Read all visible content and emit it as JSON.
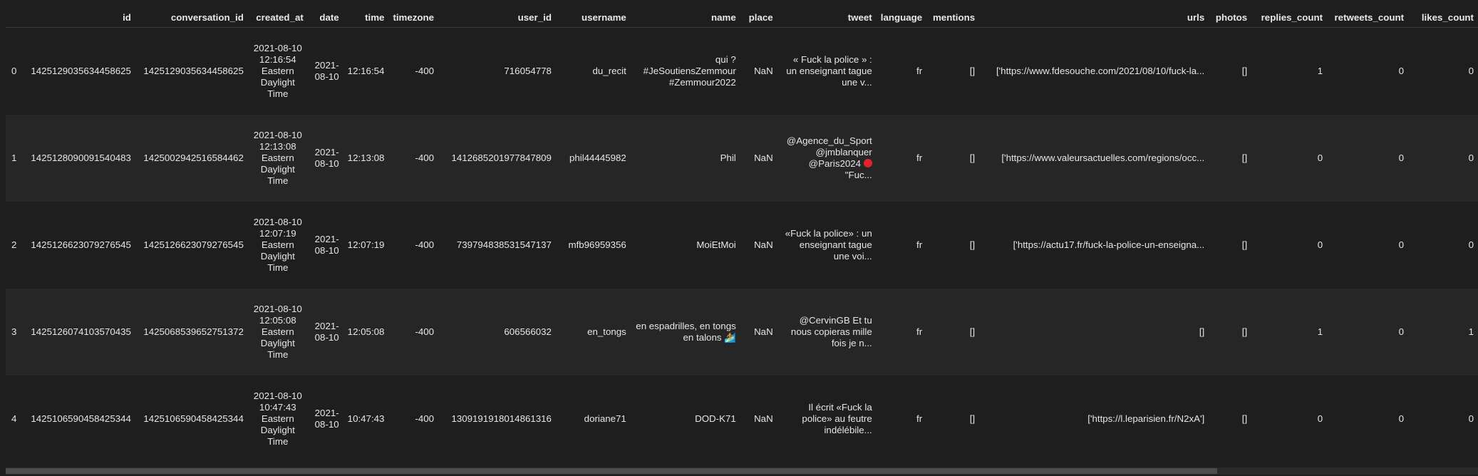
{
  "columns": [
    "",
    "id",
    "conversation_id",
    "created_at",
    "date",
    "time",
    "timezone",
    "user_id",
    "username",
    "name",
    "place",
    "tweet",
    "language",
    "mentions",
    "urls",
    "photos",
    "replies_count",
    "retweets_count",
    "likes_count"
  ],
  "rows": [
    {
      "index": "0",
      "id": "1425129035634458625",
      "conversation_id": "1425129035634458625",
      "created_at": "2021-08-10 12:16:54 Eastern Daylight Time",
      "date": "2021-08-10",
      "time": "12:16:54",
      "timezone": "-400",
      "user_id": "716054778",
      "username": "du_recit",
      "name": "qui ? #JeSoutiensZemmour #Zemmour2022",
      "place": "NaN",
      "tweet": "« Fuck la police » : un enseignant tague une v...",
      "language": "fr",
      "mentions": "[]",
      "urls": "['https://www.fdesouche.com/2021/08/10/fuck-la...",
      "photos": "[]",
      "replies_count": "1",
      "retweets_count": "0",
      "likes_count": "0"
    },
    {
      "index": "1",
      "id": "1425128090091540483",
      "conversation_id": "1425002942516584462",
      "created_at": "2021-08-10 12:13:08 Eastern Daylight Time",
      "date": "2021-08-10",
      "time": "12:13:08",
      "timezone": "-400",
      "user_id": "1412685201977847809",
      "username": "phil44445982",
      "name": "Phil",
      "place": "NaN",
      "tweet_before_dot": "@Agence_du_Sport @jmblanquer @Paris2024 ",
      "tweet_after_dot": " \"Fuc...",
      "language": "fr",
      "mentions": "[]",
      "urls": "['https://www.valeursactuelles.com/regions/occ...",
      "photos": "[]",
      "replies_count": "0",
      "retweets_count": "0",
      "likes_count": "0"
    },
    {
      "index": "2",
      "id": "1425126623079276545",
      "conversation_id": "1425126623079276545",
      "created_at": "2021-08-10 12:07:19 Eastern Daylight Time",
      "date": "2021-08-10",
      "time": "12:07:19",
      "timezone": "-400",
      "user_id": "739794838531547137",
      "username": "mfb96959356",
      "name": "MoiEtMoi",
      "place": "NaN",
      "tweet": "«Fuck la police» : un enseignant tague une voi...",
      "language": "fr",
      "mentions": "[]",
      "urls": "['https://actu17.fr/fuck-la-police-un-enseigna...",
      "photos": "[]",
      "replies_count": "0",
      "retweets_count": "0",
      "likes_count": "0"
    },
    {
      "index": "3",
      "id": "1425126074103570435",
      "conversation_id": "1425068539652751372",
      "created_at": "2021-08-10 12:05:08 Eastern Daylight Time",
      "date": "2021-08-10",
      "time": "12:05:08",
      "timezone": "-400",
      "user_id": "606566032",
      "username": "en_tongs",
      "name": "en espadrilles, en tongs en talons 🏄",
      "place": "NaN",
      "tweet": "@CervinGB Et tu nous copieras mille fois je n...",
      "language": "fr",
      "mentions": "[]",
      "urls": "[]",
      "photos": "[]",
      "replies_count": "1",
      "retweets_count": "0",
      "likes_count": "1"
    },
    {
      "index": "4",
      "id": "1425106590458425344",
      "conversation_id": "1425106590458425344",
      "created_at": "2021-08-10 10:47:43 Eastern Daylight Time",
      "date": "2021-08-10",
      "time": "10:47:43",
      "timezone": "-400",
      "user_id": "1309191918014861316",
      "username": "doriane71",
      "name": "DOD-K71",
      "place": "NaN",
      "tweet": "Il écrit «Fuck la police» au feutre indélébile...",
      "language": "fr",
      "mentions": "[]",
      "urls": "['https://l.leparisien.fr/N2xA']",
      "photos": "[]",
      "replies_count": "0",
      "retweets_count": "0",
      "likes_count": "0"
    }
  ],
  "colors": {
    "background": "#1e1e1e",
    "row_alt": "#262626",
    "text": "#e6e6e6",
    "scroll_thumb": "#4d4d4d",
    "red_circle": "#e0242c"
  }
}
